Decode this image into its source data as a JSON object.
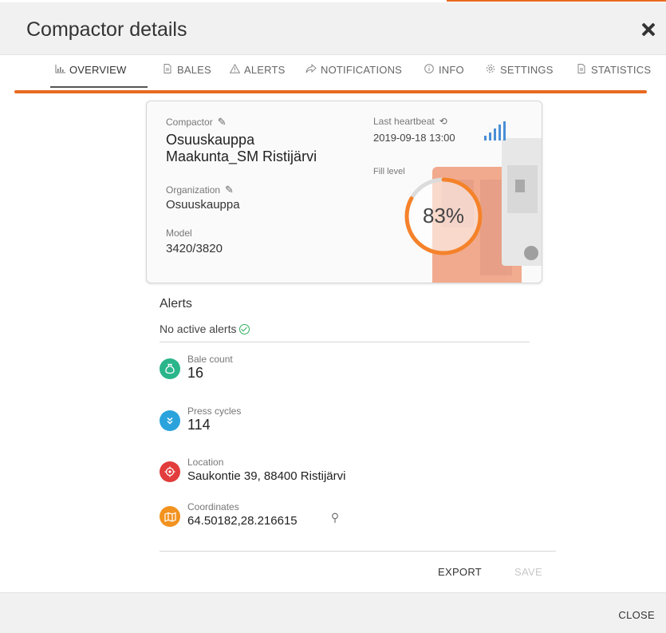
{
  "header": {
    "title": "Compactor details",
    "close_icon": "close-icon"
  },
  "tabs": [
    {
      "label": "OVERVIEW",
      "icon": "chart-icon",
      "active": true
    },
    {
      "label": "BALES",
      "icon": "document-icon"
    },
    {
      "label": "ALERTS",
      "icon": "warning-icon"
    },
    {
      "label": "NOTIFICATIONS",
      "icon": "share-icon"
    },
    {
      "label": "INFO",
      "icon": "info-icon"
    },
    {
      "label": "SETTINGS",
      "icon": "gear-icon"
    },
    {
      "label": "STATISTICS",
      "icon": "document-icon"
    }
  ],
  "card": {
    "compactor_label": "Compactor",
    "compactor_name_line1": "Osuuskauppa",
    "compactor_name_line2": "Maakunta_SM Ristijärvi",
    "organization_label": "Organization",
    "organization_value": "Osuuskauppa",
    "model_label": "Model",
    "model_value": "3420/3820",
    "heartbeat_label": "Last heartbeat",
    "heartbeat_value": "2019-09-18 13:00",
    "fill_label": "Fill level",
    "fill_text": "83%",
    "fill_fraction": 0.83,
    "accent_color": "#f5822a",
    "signal_color": "#4a8fd6"
  },
  "alerts": {
    "title": "Alerts",
    "status": "No active alerts"
  },
  "stats": {
    "bale_label": "Bale count",
    "bale_value": "16",
    "press_label": "Press cycles",
    "press_value": "114",
    "location_label": "Location",
    "location_value": "Saukontie 39, 88400 Ristijärvi",
    "coordinates_label": "Coordinates",
    "coordinates_value": "64.50182,28.216615",
    "colors": {
      "bale": "#2bb58a",
      "press": "#2aa3dc",
      "location": "#e23c3c",
      "coordinates": "#f2921f"
    }
  },
  "actions": {
    "export": "EXPORT",
    "save": "SAVE",
    "close": "CLOSE"
  }
}
